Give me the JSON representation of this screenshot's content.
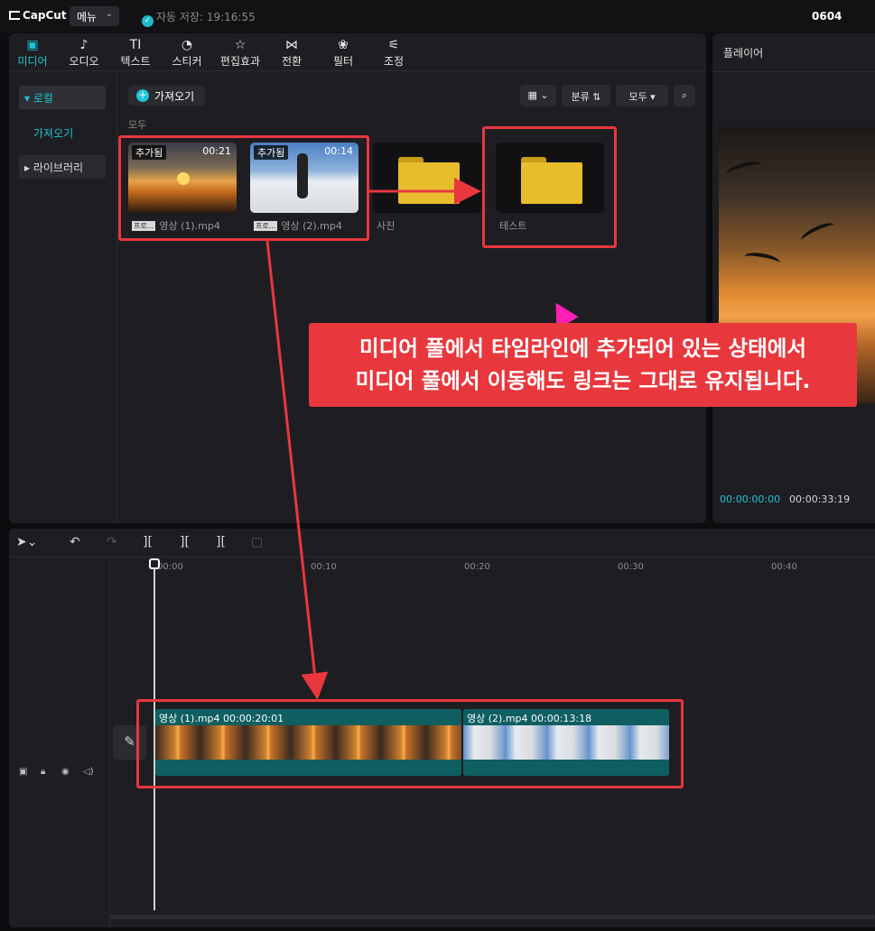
{
  "app": {
    "logo": "CapCut",
    "menu_label": "메뉴",
    "save_status": "자동 저장: 19:16:55",
    "project_name": "0604"
  },
  "tabs": [
    {
      "label": "미디어",
      "icon": "media-icon",
      "active": true
    },
    {
      "label": "오디오",
      "icon": "audio-icon"
    },
    {
      "label": "텍스트",
      "icon": "text-icon",
      "glyph": "TI"
    },
    {
      "label": "스티커",
      "icon": "sticker-icon"
    },
    {
      "label": "편집효과",
      "icon": "effects-icon"
    },
    {
      "label": "전환",
      "icon": "transition-icon"
    },
    {
      "label": "필터",
      "icon": "filter-icon"
    },
    {
      "label": "조정",
      "icon": "adjust-icon"
    }
  ],
  "sidebar": {
    "local": "▾ 로컬",
    "import": "가져오기",
    "library": "▸ 라이브러리"
  },
  "toolbar": {
    "import_label": "가져오기",
    "sort_label": "분류",
    "filter_label": "모두",
    "all_label": "모두"
  },
  "media_items": [
    {
      "name": "영상 (1).mp4",
      "badge": "추가됨",
      "duration": "00:21",
      "tag": "프로..."
    },
    {
      "name": "영상 (2).mp4",
      "badge": "추가됨",
      "duration": "00:14",
      "tag": "프로..."
    },
    {
      "name": "사진",
      "kind": "folder"
    },
    {
      "name": "테스트",
      "kind": "folder"
    }
  ],
  "callout": {
    "line1": "미디어 풀에서 타임라인에 추가되어 있는 상태에서",
    "line2": "미디어 풀에서 이동해도 링크는 그대로 유지됩니다."
  },
  "player": {
    "title": "플레이어",
    "current_time": "00:00:00:00",
    "total_time": "00:00:33:19"
  },
  "timeline": {
    "ticks": [
      "00:00",
      "00:10",
      "00:20",
      "00:30",
      "00:40"
    ],
    "clips": [
      {
        "name": "영상 (1).mp4",
        "duration": "00:00:20:01"
      },
      {
        "name": "영상 (2).mp4",
        "duration": "00:00:13:18"
      }
    ]
  },
  "colors": {
    "accent": "#1fc3d6",
    "annotation_red": "#e8373d",
    "clip_teal": "#0f5e60"
  }
}
